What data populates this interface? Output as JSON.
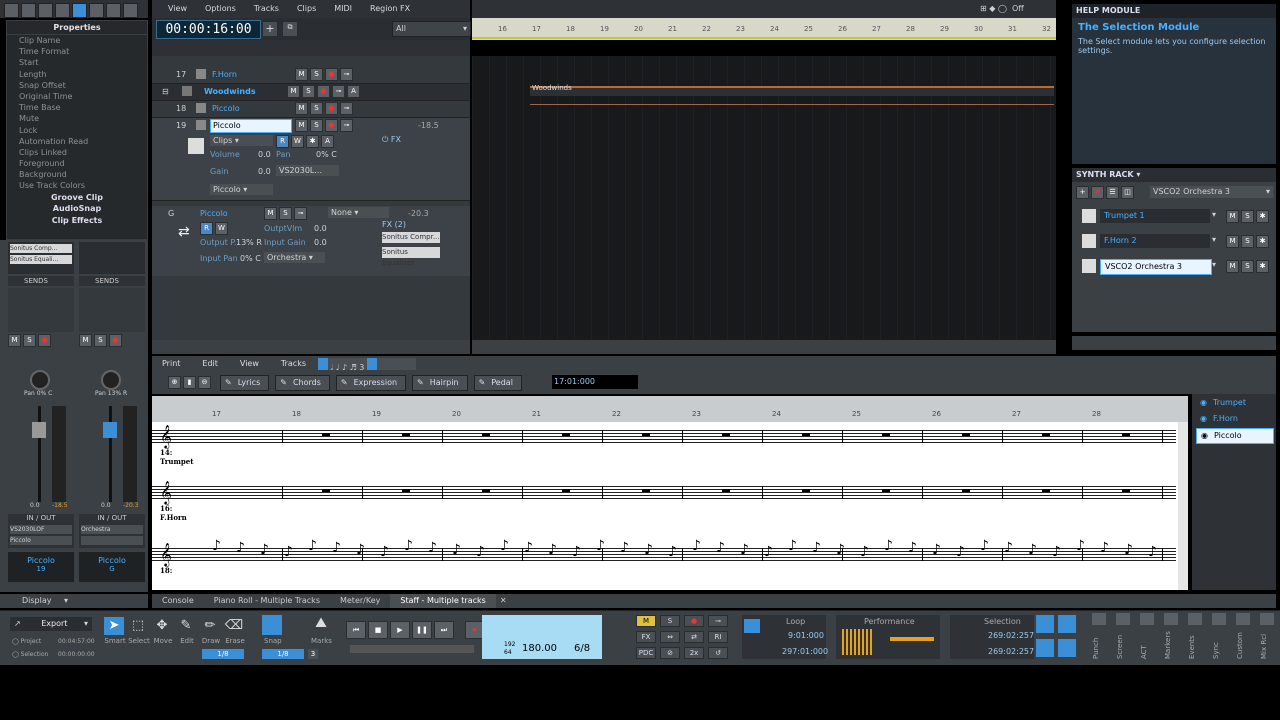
{
  "toolbar_top": {
    "menus": [
      "View",
      "Options",
      "Tracks",
      "Clips",
      "MIDI",
      "Region FX"
    ],
    "time": "00:00:16:00",
    "filter": "All",
    "off_label": "Off"
  },
  "properties": {
    "title": "Properties",
    "items": [
      "Clip Name",
      "Time Format",
      "Start",
      "Length",
      "Snap Offset",
      "Original Time",
      "Time Base",
      "Mute",
      "Lock",
      "Automation Read",
      "Clips Linked",
      "Foreground",
      "Background",
      "Use Track Colors"
    ],
    "sections": [
      "Groove Clip",
      "AudioSnap",
      "Clip Effects"
    ]
  },
  "tracks": [
    {
      "num": "17",
      "name": "F.Horn"
    },
    {
      "num": "",
      "name": "Woodwinds"
    },
    {
      "num": "18",
      "name": "Piccolo"
    },
    {
      "num": "19",
      "name": "Piccolo"
    }
  ],
  "track19": {
    "db": "-18.5",
    "clips": "Clips",
    "volume_label": "Volume",
    "volume_val": "0.0",
    "pan_label": "Pan",
    "pan_val": "0% C",
    "gain_label": "Gain",
    "gain_val": "0.0",
    "output": "VS2030L...",
    "input": "Piccolo",
    "fx": "FX"
  },
  "bus": {
    "g": "G",
    "name": "Piccolo",
    "none": "None",
    "db": "-20.3",
    "outvol_label": "OutptVlm",
    "outvol": "0.0",
    "outpan_label": "Output P..",
    "outpan": "13% R",
    "ingain_label": "Input Gain",
    "ingain": "0.0",
    "inpan_label": "Input Pan",
    "inpan": "0% C",
    "out": "Orchestra",
    "fx": "FX (2)",
    "fx_items": [
      "Sonitus Compr...",
      "Sonitus Equalizer"
    ]
  },
  "clip_label": "Woodwinds",
  "ruler": [
    "16",
    "17",
    "18",
    "19",
    "20",
    "21",
    "22",
    "23",
    "24",
    "25",
    "26",
    "27",
    "28",
    "29",
    "30",
    "31",
    "32"
  ],
  "help": {
    "header": "HELP MODULE",
    "title": "The Selection Module",
    "body": "The Select module lets you configure selection settings."
  },
  "synth": {
    "header": "SYNTH RACK",
    "select": "VSCO2 Orchestra 3",
    "items": [
      "Trumpet 1",
      "F.Horn 2",
      "VSCO2 Orchestra 3"
    ]
  },
  "strips": [
    {
      "fx": [
        "Sonitus Comp...",
        "Sonitus Equali..."
      ],
      "sends": "SENDS",
      "pan": "Pan 0% C",
      "vol": "0.0",
      "peak": "-18.5",
      "io": "IN / OUT",
      "out": "VS2030LOF",
      "in": "Piccolo",
      "name": "Piccolo",
      "num": "19"
    },
    {
      "fx": [],
      "sends": "SENDS",
      "pan": "Pan 13% R",
      "vol": "0.0",
      "peak": "-20.3",
      "io": "IN / OUT",
      "out": "Orchestra",
      "in": "",
      "name": "Piccolo",
      "num": "G"
    }
  ],
  "display_label": "Display",
  "staff": {
    "menus": [
      "Print",
      "Edit",
      "View",
      "Tracks"
    ],
    "tools": [
      "Lyrics",
      "Chords",
      "Expression",
      "Hairpin",
      "Pedal"
    ],
    "time": "17:01:000",
    "measures": [
      "17",
      "18",
      "19",
      "20",
      "21",
      "22",
      "23",
      "24",
      "25",
      "26",
      "27",
      "28"
    ],
    "staves": [
      {
        "num": "14:",
        "name": "Trumpet"
      },
      {
        "num": "16:",
        "name": "F.Horn"
      },
      {
        "num": "18:",
        "name": ""
      }
    ],
    "track_list": [
      "Trumpet",
      "F.Horn",
      "Piccolo"
    ]
  },
  "tabs": [
    "Console",
    "Piano Roll - Multiple Tracks",
    "Meter/Key",
    "Staff - Multiple tracks"
  ],
  "control": {
    "export": "Export",
    "project": "Project",
    "project_time": "00:04:57:00",
    "selection": "Selection",
    "selection_time": "00:00:00:00",
    "tools": [
      "Smart",
      "Select",
      "Move",
      "Edit",
      "Draw",
      "Erase"
    ],
    "snap_label": "Snap",
    "marks_label": "Marks",
    "snap_val": "1/8",
    "snap_val2": "1/8",
    "snap_3": "3",
    "tempo": "180.00",
    "meter": "6/8",
    "ppq_top": "192",
    "ppq_bot": "64",
    "loop": "Loop",
    "loop_start": "9:01:000",
    "loop_end": "297:01:000",
    "performance": "Performance",
    "sel_label": "Selection",
    "sel_start": "269:02:257",
    "sel_end": "269:02:257",
    "vertical": [
      "Punch",
      "Screen",
      "ACT",
      "Markers",
      "Events",
      "Sync",
      "Custom",
      "Mix Rcl"
    ],
    "m": "M",
    "s": "S",
    "fx": "FX",
    "ri": "RI",
    "pdc": "PDC",
    "twox": "2x"
  }
}
